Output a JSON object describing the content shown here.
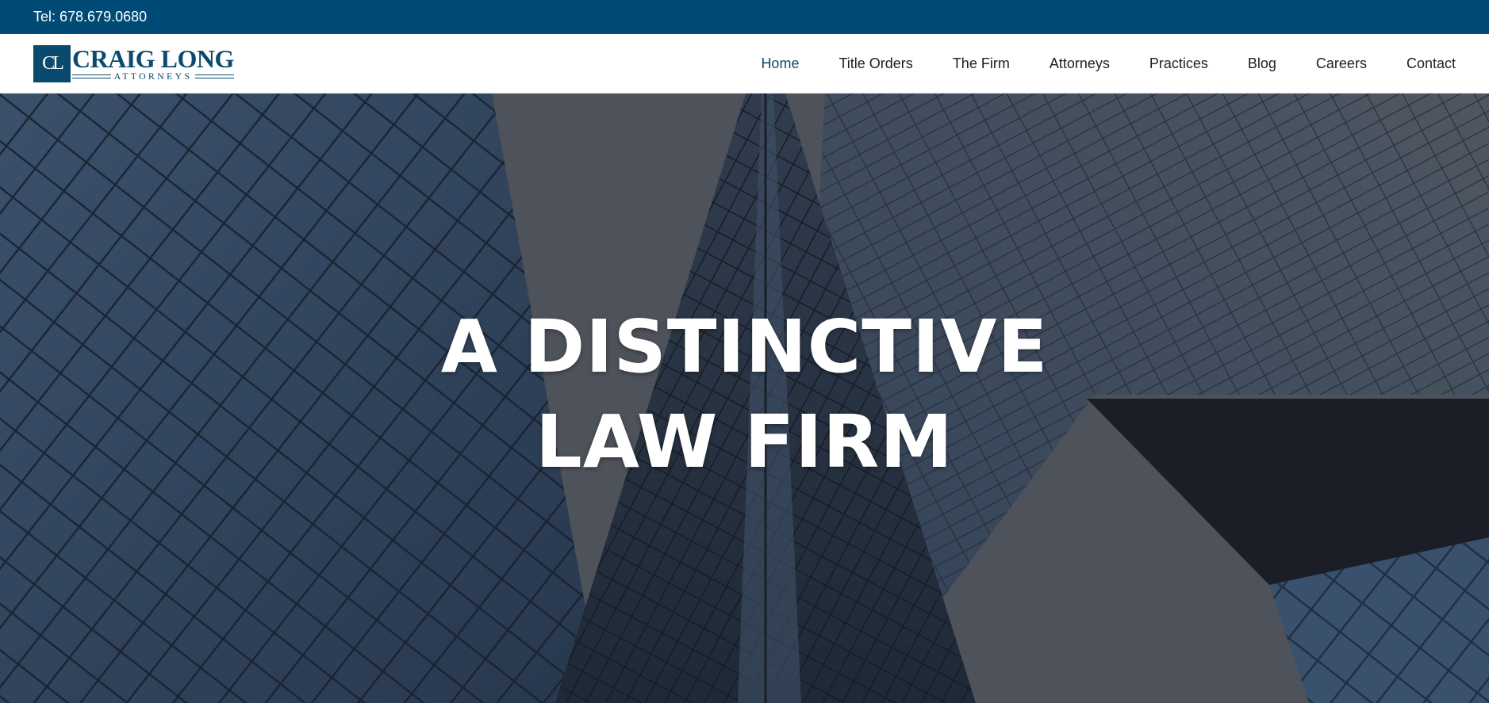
{
  "topbar": {
    "phone": "Tel: 678.679.0680"
  },
  "logo": {
    "monogram": "CL",
    "name": "CRAIG LONG",
    "subtitle": "ATTORNEYS"
  },
  "nav": {
    "items": [
      {
        "label": "Home",
        "active": true
      },
      {
        "label": "Title Orders"
      },
      {
        "label": "The Firm"
      },
      {
        "label": "Attorneys"
      },
      {
        "label": "Practices"
      },
      {
        "label": "Blog"
      },
      {
        "label": "Careers"
      },
      {
        "label": "Contact"
      }
    ]
  },
  "hero": {
    "line1": "A DISTINCTIVE",
    "line2": "LAW FIRM",
    "background": "glass-skyscraper-photo"
  },
  "colors": {
    "topbar": "#004b75",
    "brand": "#0b4a6f",
    "nav_text": "#1e1e1e",
    "hero_text": "#ffffff"
  }
}
